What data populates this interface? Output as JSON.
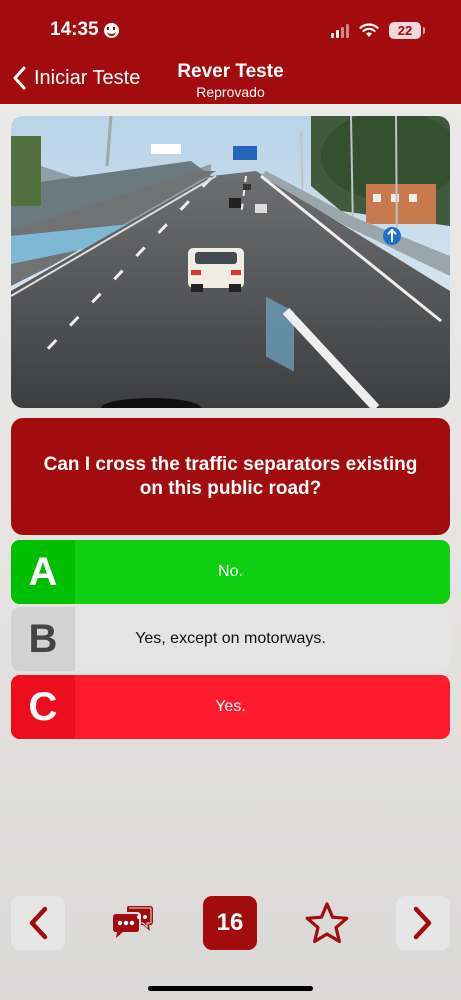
{
  "status_bar": {
    "time": "14:35",
    "battery": "22"
  },
  "nav": {
    "back_label": "Iniciar Teste",
    "title": "Rever Teste",
    "subtitle": "Reprovado"
  },
  "question": {
    "text": "Can I cross the traffic separators existing on this public road?"
  },
  "answers": [
    {
      "letter": "A",
      "text": "No.",
      "state": "correct",
      "color": "#0ecf12"
    },
    {
      "letter": "B",
      "text": "Yes, except on motorways.",
      "state": "neutral",
      "color": "#e4e4e4"
    },
    {
      "letter": "C",
      "text": "Yes.",
      "state": "wrong",
      "color": "#fd1b2b"
    }
  ],
  "toolbar": {
    "question_number": "16"
  },
  "colors": {
    "brand": "#a20c0e",
    "correct": "#0ecf12",
    "wrong": "#fd1b2b"
  },
  "icons": [
    "chevron-left-icon",
    "chat-icon",
    "star-icon",
    "chevron-right-icon",
    "wifi-icon",
    "signal-icon",
    "battery-icon",
    "smile-icon"
  ]
}
